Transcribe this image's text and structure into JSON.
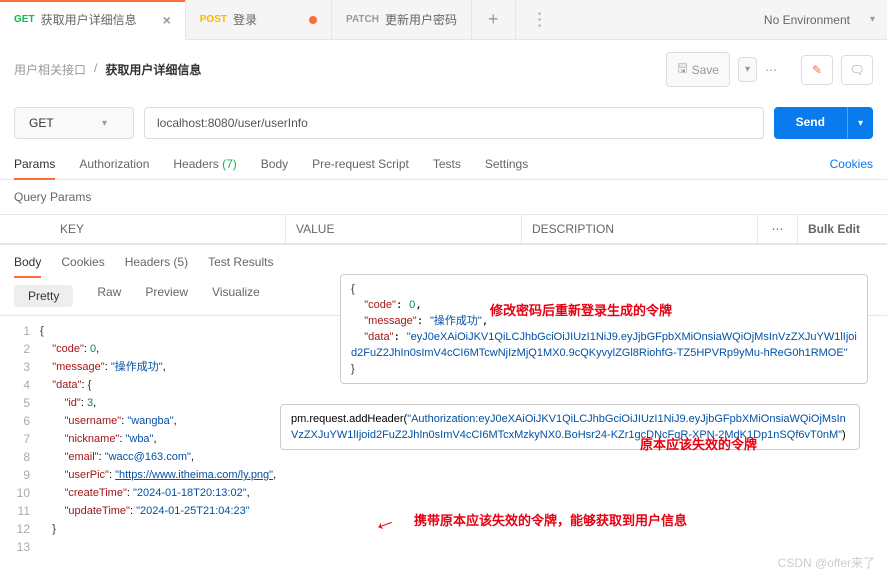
{
  "top_tabs": [
    {
      "method": "GET",
      "name": "获取用户详细信息",
      "method_class": "get"
    },
    {
      "method": "POST",
      "name": "登录",
      "method_class": "post"
    },
    {
      "method": "PATCH",
      "name": "更新用户密码",
      "method_class": "patch"
    }
  ],
  "env": "No Environment",
  "breadcrumb": {
    "folder": "用户相关接口",
    "current": "获取用户详细信息"
  },
  "save_label": "Save",
  "request": {
    "method": "GET",
    "url": "localhost:8080/user/userInfo",
    "send": "Send"
  },
  "req_tabs": {
    "params": "Params",
    "auth": "Authorization",
    "headers": "Headers",
    "headers_count": "(7)",
    "body": "Body",
    "prereq": "Pre-request Script",
    "tests": "Tests",
    "settings": "Settings",
    "cookies": "Cookies"
  },
  "query_params_title": "Query Params",
  "cols": {
    "key": "KEY",
    "value": "VALUE",
    "desc": "DESCRIPTION",
    "bulk": "Bulk Edit"
  },
  "resp_tabs": {
    "body": "Body",
    "cookies": "Cookies",
    "headers": "Headers",
    "hcount": "(5)",
    "tests": "Test Results"
  },
  "view_modes": {
    "pretty": "Pretty",
    "raw": "Raw",
    "preview": "Preview",
    "visualize": "Visualize"
  },
  "overlay1": {
    "code": "\"code\"",
    "code_v": "0",
    "msg": "\"message\"",
    "msg_v": "\"操作成功\"",
    "data": "\"data\"",
    "token": "\"eyJ0eXAiOiJKV1QiLCJhbGciOiJIUzI1NiJ9.eyJjbGFpbXMiOnsiaWQiOjMsInVzZXJuYW1lIjoid2FuZ2JhIn0sImV4cCI6MTcwNjIzMjQ1MX0.9cQKyvylZGl8RiohfG-TZ5HPVRp9yMu-hReG0h1RMOE\""
  },
  "overlay2": {
    "pre": "pm.request.addHeader(",
    "token": "\"Authorization:eyJ0eXAiOiJKV1QiLCJhbGciOiJIUzI1NiJ9.eyJjbGFpbXMiOnsiaWQiOjMsInVzZXJuYW1lIjoid2FuZ2JhIn0sImV4cCI6MTcxMzkyNX0.BoHsr24-KZr1gcDNcFqR-XPN-2MdK1Dp1nSQf6vT0nM\"",
    "post": ")"
  },
  "annotations": {
    "a1": "修改密码后重新登录生成的令牌",
    "a2": "原本应该失效的令牌",
    "a3": "携带原本应该失效的令牌，能够获取到用户信息"
  },
  "response_json": {
    "lines": [
      "1",
      "2",
      "3",
      "4",
      "5",
      "6",
      "7",
      "8",
      "9",
      "10",
      "11",
      "12",
      "13"
    ],
    "code": "\"code\"",
    "code_v": "0",
    "message": "\"message\"",
    "message_v": "\"操作成功\"",
    "data": "\"data\"",
    "id": "\"id\"",
    "id_v": "3",
    "username": "\"username\"",
    "username_v": "\"wangba\"",
    "nickname": "\"nickname\"",
    "nickname_v": "\"wba\"",
    "email": "\"email\"",
    "email_v": "\"wacc@163.com\"",
    "userPic": "\"userPic\"",
    "userPic_v": "\"https://www.itheima.com/ly.png\"",
    "createTime": "\"createTime\"",
    "createTime_v": "\"2024-01-18T20:13:02\"",
    "updateTime": "\"updateTime\"",
    "updateTime_v": "\"2024-01-25T21:04:23\""
  },
  "watermark": "CSDN @offer来了"
}
